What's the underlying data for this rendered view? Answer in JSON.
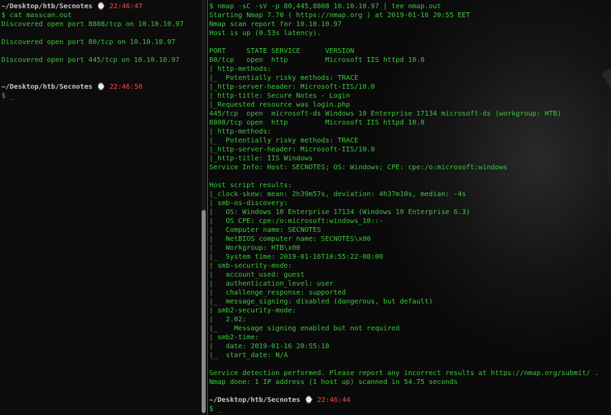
{
  "left_terminal": {
    "prompts": [
      {
        "path": "~/Desktop/htb/Secnotes",
        "clock": "⌚",
        "time": "22:46:47"
      },
      {
        "path": "~/Desktop/htb/Secnotes",
        "clock": "⌚",
        "time": "22:46:50"
      }
    ],
    "lines": [
      "$ cat masscan.out",
      "Discovered open port 8808/tcp on 10.10.10.97",
      "",
      "Discovered open port 80/tcp on 10.10.10.97",
      "",
      "Discovered open port 445/tcp on 10.10.10.97",
      "",
      "",
      "$ _"
    ]
  },
  "right_terminal": {
    "lines": [
      "$ nmap -sC -sV -p 80,445,8808 10.10.10.97 | tee nmap.out",
      "Starting Nmap 7.70 ( https://nmap.org ) at 2019-01-16 20:55 EET",
      "Nmap scan report for 10.10.10.97",
      "Host is up (0.53s latency).",
      "",
      "PORT     STATE SERVICE      VERSION",
      "80/tcp   open  http         Microsoft IIS httpd 10.0",
      "| http-methods:",
      "|_  Potentially risky methods: TRACE",
      "|_http-server-header: Microsoft-IIS/10.0",
      "| http-title: Secure Notes - Login",
      "|_Requested resource was login.php",
      "445/tcp  open  microsoft-ds Windows 10 Enterprise 17134 microsoft-ds (workgroup: HTB)",
      "8808/tcp open  http         Microsoft IIS httpd 10.0",
      "| http-methods:",
      "|_  Potentially risky methods: TRACE",
      "|_http-server-header: Microsoft-IIS/10.0",
      "|_http-title: IIS Windows",
      "Service Info: Host: SECNOTES; OS: Windows; CPE: cpe:/o:microsoft:windows",
      "",
      "Host script results:",
      "|_clock-skew: mean: 2h39m57s, deviation: 4h37m10s, median: -4s",
      "| smb-os-discovery:",
      "|   OS: Windows 10 Enterprise 17134 (Windows 10 Enterprise 6.3)",
      "|   OS CPE: cpe:/o:microsoft:windows_10::-",
      "|   Computer name: SECNOTES",
      "|   NetBIOS computer name: SECNOTES\\x00",
      "|   Workgroup: HTB\\x00",
      "|_  System time: 2019-01-16T10:55:22-08:00",
      "| smb-security-mode:",
      "|   account_used: guest",
      "|   authentication_level: user",
      "|   challenge_response: supported",
      "|_  message_signing: disabled (dangerous, but default)",
      "| smb2-security-mode:",
      "|   2.02:",
      "|_    Message signing enabled but not required",
      "| smb2-time:",
      "|   date: 2019-01-16 20:55:18",
      "|_  start_date: N/A",
      "",
      "Service detection performed. Please report any incorrect results at https://nmap.org/submit/ .",
      "Nmap done: 1 IP address (1 host up) scanned in 54.75 seconds",
      ""
    ],
    "prompt": {
      "path": "~/Desktop/htb/Secnotes",
      "clock": "⌚",
      "time": "22:46:44"
    },
    "cursor_line": "$ _"
  }
}
